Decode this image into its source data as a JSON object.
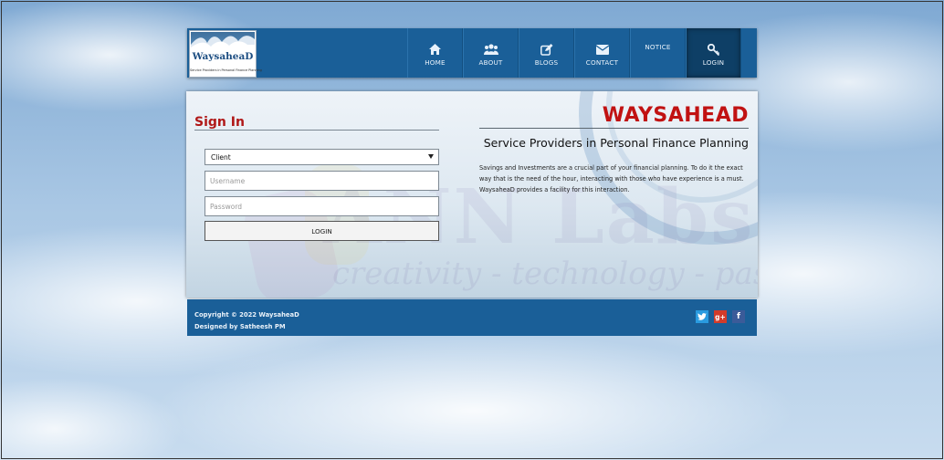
{
  "logo": {
    "name": "WaysaheaD",
    "tagline": "Service Providers in Personal Finance Planning"
  },
  "nav": {
    "home": "HOME",
    "about": "ABOUT",
    "blogs": "BLOGS",
    "contact": "CONTACT",
    "notice": "NOTICE",
    "login": "LOGIN"
  },
  "signin": {
    "title": "Sign In",
    "role_selected": "Client",
    "username_placeholder": "Username",
    "password_placeholder": "Password",
    "login_button": "LOGIN"
  },
  "brand": {
    "title": "WAYSAHEAD",
    "subtitle": "Service Providers in Personal Finance Planning",
    "description": "Savings and Investments are a crucial part of your financial planning. To do it the exact way that is the need of the hour, interacting with those who have experience is a must. WaysaheaD provides a facility for this interaction."
  },
  "watermark": {
    "title": "ANN Labs",
    "slogan": "creativity - technology - passion"
  },
  "footer": {
    "copyright": "Copyright © 2022 WaysaheaD",
    "designer": "Designed by Satheesh PM",
    "social": [
      "twitter-icon",
      "google-plus-icon",
      "facebook-icon"
    ]
  },
  "colors": {
    "header": "#1a5f98",
    "accent_red": "#c11212",
    "active_tab": "#0e3f66"
  }
}
